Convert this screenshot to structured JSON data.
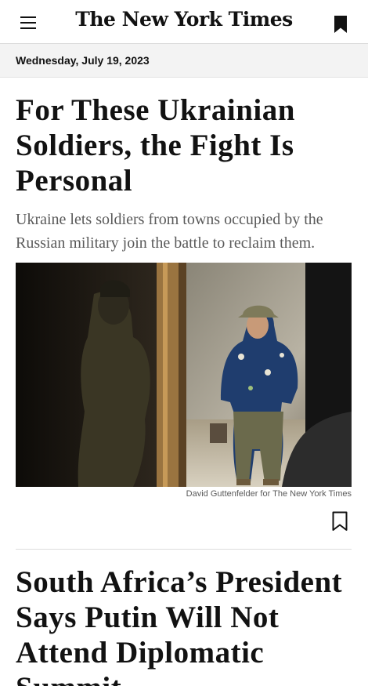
{
  "header": {
    "logo_text": "The New York Times",
    "menu_icon": "hamburger-menu-icon",
    "bookmark_icon": "bookmark-filled-icon"
  },
  "date_bar": {
    "date": "Wednesday, July 19, 2023"
  },
  "stories": [
    {
      "headline": "For These Ukrainian Soldiers, the Fight Is Personal",
      "summary": "Ukraine lets soldiers from towns occupied by the Russian military join the battle to reclaim them.",
      "photo_credit": "David Guttenfelder for The New York Times",
      "save_icon": "bookmark-outline-icon"
    },
    {
      "headline": "South Africa’s President Says Putin Will Not Attend Diplomatic Summit"
    }
  ],
  "colors": {
    "text": "#121212",
    "summary_text": "#5a5a5a",
    "date_bar_bg": "#f3f3f3",
    "divider": "#dcdcdc"
  }
}
